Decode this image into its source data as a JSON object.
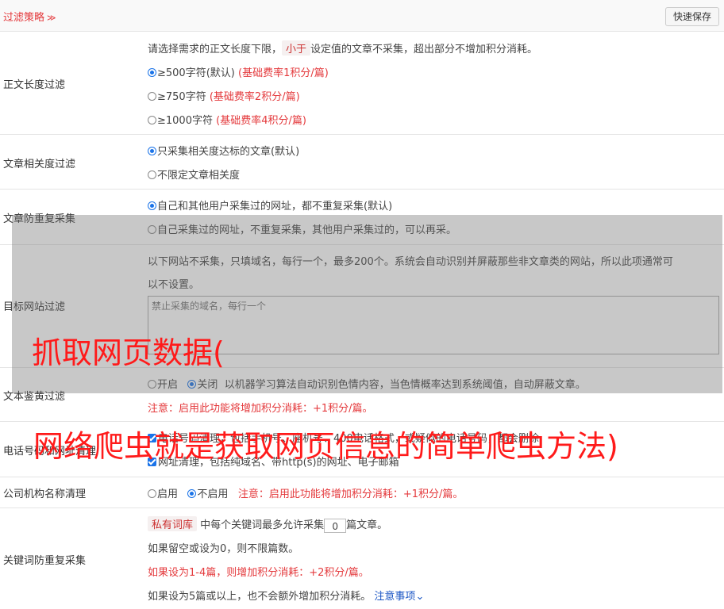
{
  "header": {
    "title": "过滤策略",
    "save": "快速保存"
  },
  "length": {
    "label": "正文长度过滤",
    "desc_pre": "请选择需求的正文长度下限，",
    "desc_tag": "小于",
    "desc_post": "设定值的文章不采集，超出部分不增加积分消耗。",
    "opt1": "≥500字符(默认)",
    "opt1_fee": "(基础费率1积分/篇)",
    "opt2": "≥750字符",
    "opt2_fee": "(基础费率2积分/篇)",
    "opt3": "≥1000字符",
    "opt3_fee": "(基础费率4积分/篇)"
  },
  "relevance": {
    "label": "文章相关度过滤",
    "opt1": "只采集相关度达标的文章(默认)",
    "opt2": "不限定文章相关度"
  },
  "dedup": {
    "label": "文章防重复采集",
    "opt1": "自己和其他用户采集过的网址，都不重复采集(默认)",
    "opt2": "自己采集过的网址，不重复采集，其他用户采集过的，可以再采。"
  },
  "site": {
    "label": "目标网站过滤",
    "desc1": "以下网站不采集，只填域名，每行一个，最多200个。系统会自动识别并屏蔽那些非文章类的网站，所以此项通常可",
    "desc2": "以不设置。",
    "placeholder": "禁止采集的域名，每行一个"
  },
  "porn": {
    "label": "文本鉴黄过滤",
    "on": "开启",
    "off": "关闭",
    "desc": "以机器学习算法自动识别色情内容，当色情概率达到系统阈值，自动屏蔽文章。",
    "note": "注意：启用此功能将增加积分消耗：+1积分/篇。"
  },
  "phone": {
    "label": "电话号码和网址清理",
    "line1": "电话号码清理，包括手机号、座机号、400电话格式，或疑似的电话号码，都会删除",
    "line2": "网址清理，包括纯域名、带http(s)的网址、电子邮箱"
  },
  "company": {
    "label": "公司机构名称清理",
    "on": "启用",
    "off": "不启用",
    "note": "注意：启用此功能将增加积分消耗：+1积分/篇。"
  },
  "keyword": {
    "label": "关键词防重复采集",
    "tag": "私有词库",
    "pre": "中每个关键词最多允许采集",
    "value": "0",
    "post": "篇文章。",
    "line2": "如果留空或设为0，则不限篇数。",
    "line3": "如果设为1-4篇，则增加积分消耗：+2积分/篇。",
    "line4": "如果设为5篇或以上，也不会额外增加积分消耗。",
    "link": "注意事项"
  },
  "overlay": {
    "title": "抓取网页数据(",
    "subtitle": "网络爬虫就是获取网页信息的简单爬虫方法)"
  }
}
